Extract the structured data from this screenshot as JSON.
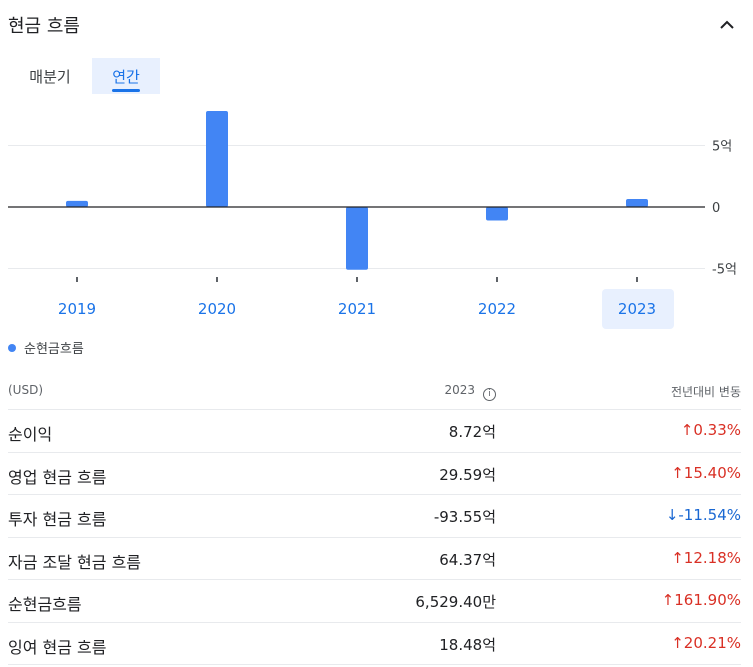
{
  "header": {
    "title": "현금 흐름"
  },
  "tabs": [
    {
      "label": "매분기"
    },
    {
      "label": "연간"
    }
  ],
  "legend": {
    "label": "순현금흐름"
  },
  "chart_data": {
    "type": "bar",
    "categories": [
      "2019",
      "2020",
      "2021",
      "2022",
      "2023"
    ],
    "series": [
      {
        "name": "순현금흐름",
        "values": [
          0.5,
          7.8,
          -5.1,
          -1.1,
          0.65
        ]
      }
    ],
    "ylim": [
      -5,
      5
    ],
    "yticks": [
      "5억",
      "0",
      "-5억"
    ],
    "selected_category": "2023",
    "colors": {
      "bar": "#4285f4",
      "zero_line": "#202124",
      "grid": "#e8eaed",
      "year_label": "#1a73e8"
    }
  },
  "table": {
    "header": {
      "label": "(USD)",
      "year": "2023",
      "change": "전년대비 변동"
    },
    "rows": [
      {
        "label": "순이익",
        "value": "8.72억",
        "change": "0.33%",
        "dir": "up"
      },
      {
        "label": "영업 현금 흐름",
        "value": "29.59억",
        "change": "15.40%",
        "dir": "up"
      },
      {
        "label": "투자 현금 흐름",
        "value": "-93.55억",
        "change": "-11.54%",
        "dir": "down"
      },
      {
        "label": "자금 조달 현금 흐름",
        "value": "64.37억",
        "change": "12.18%",
        "dir": "up"
      },
      {
        "label": "순현금흐름",
        "value": "6,529.40만",
        "change": "161.90%",
        "dir": "up"
      },
      {
        "label": "잉여 현금 흐름",
        "value": "18.48억",
        "change": "20.21%",
        "dir": "up"
      }
    ]
  }
}
